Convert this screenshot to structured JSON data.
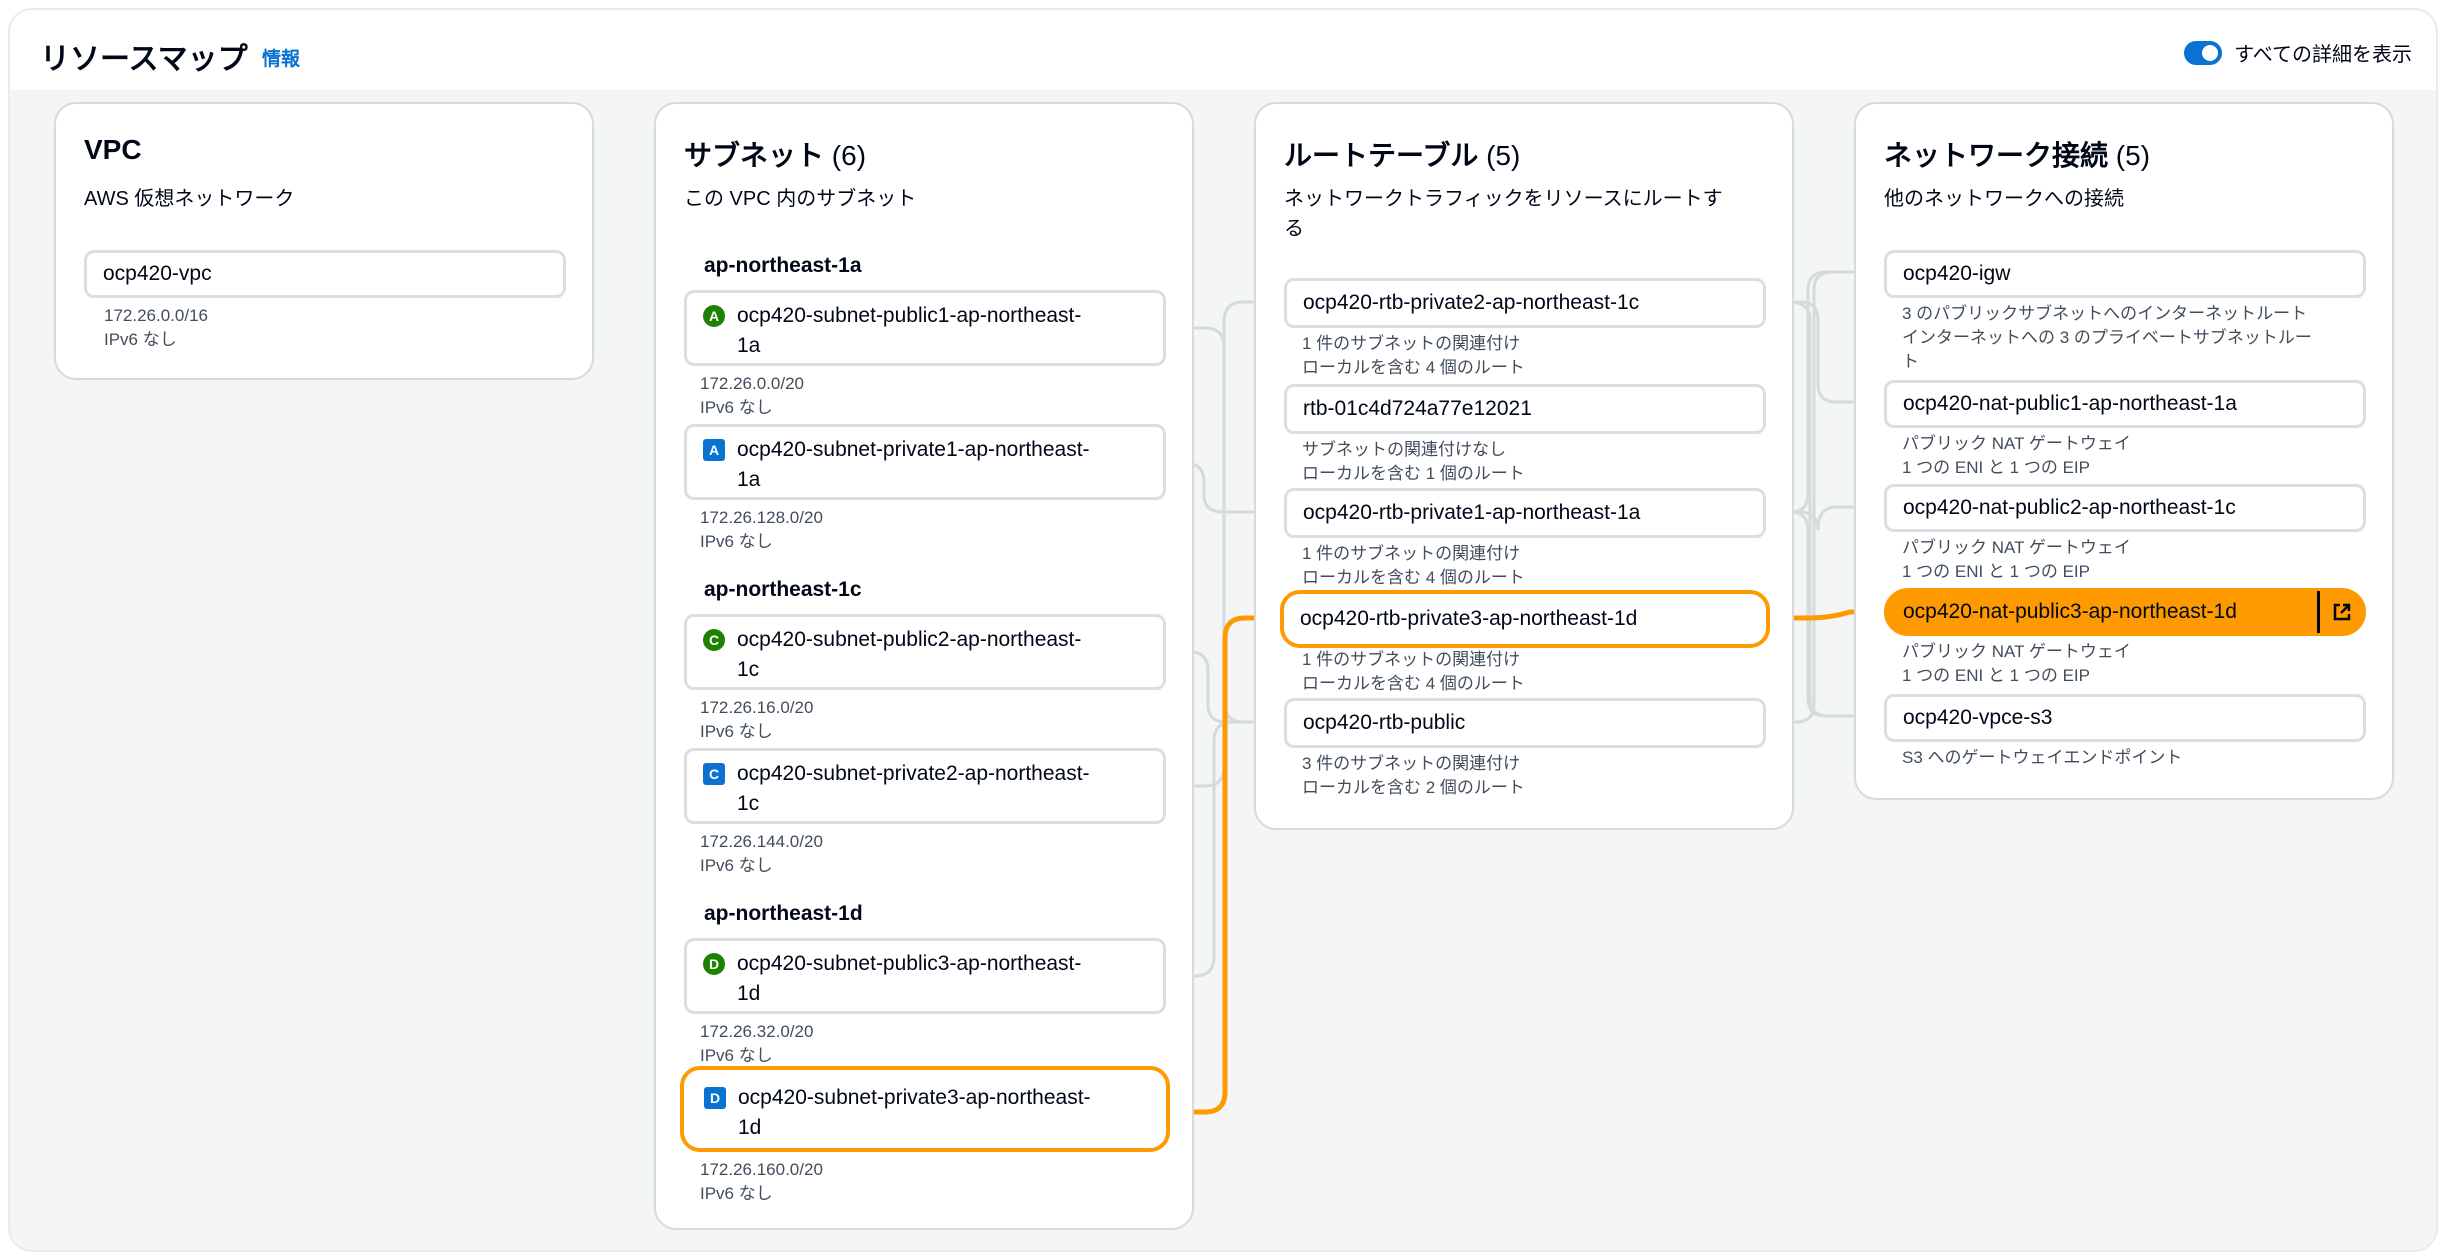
{
  "header": {
    "title": "リソースマップ",
    "info_link": "情報",
    "toggle_label": "すべての詳細を表示",
    "toggle_on": true
  },
  "colors": {
    "accent": "#ff9900",
    "link": "#0972d3",
    "public": "#1d8102",
    "private": "#0972d3"
  },
  "vpc": {
    "title": "VPC",
    "desc": "AWS 仮想ネットワーク",
    "name": "ocp420-vpc",
    "meta": [
      "172.26.0.0/16",
      "IPv6 なし"
    ]
  },
  "subnets": {
    "title": "サブネット",
    "count": "(6)",
    "desc": "この VPC 内のサブネット",
    "zones": [
      {
        "name": "ap-northeast-1a",
        "items": [
          {
            "badge": "A",
            "type": "public",
            "name": [
              "ocp420-subnet-public1-ap-northeast-",
              "1a"
            ],
            "meta": [
              "172.26.0.0/20",
              "IPv6 なし"
            ]
          },
          {
            "badge": "A",
            "type": "private",
            "name": [
              "ocp420-subnet-private1-ap-northeast-",
              "1a"
            ],
            "meta": [
              "172.26.128.0/20",
              "IPv6 なし"
            ]
          }
        ]
      },
      {
        "name": "ap-northeast-1c",
        "items": [
          {
            "badge": "C",
            "type": "public",
            "name": [
              "ocp420-subnet-public2-ap-northeast-",
              "1c"
            ],
            "meta": [
              "172.26.16.0/20",
              "IPv6 なし"
            ]
          },
          {
            "badge": "C",
            "type": "private",
            "name": [
              "ocp420-subnet-private2-ap-northeast-",
              "1c"
            ],
            "meta": [
              "172.26.144.0/20",
              "IPv6 なし"
            ]
          }
        ]
      },
      {
        "name": "ap-northeast-1d",
        "items": [
          {
            "badge": "D",
            "type": "public",
            "name": [
              "ocp420-subnet-public3-ap-northeast-",
              "1d"
            ],
            "meta": [
              "172.26.32.0/20",
              "IPv6 なし"
            ]
          },
          {
            "badge": "D",
            "type": "private",
            "name": [
              "ocp420-subnet-private3-ap-northeast-",
              "1d"
            ],
            "meta": [
              "172.26.160.0/20",
              "IPv6 なし"
            ],
            "selected": true
          }
        ]
      }
    ]
  },
  "route_tables": {
    "title": "ルートテーブル",
    "count": "(5)",
    "desc": [
      "ネットワークトラフィックをリソースにルートす",
      "る"
    ],
    "items": [
      {
        "name": "ocp420-rtb-private2-ap-northeast-1c",
        "meta": [
          "1 件のサブネットの関連付け",
          "ローカルを含む 4 個のルート"
        ]
      },
      {
        "name": "rtb-01c4d724a77e12021",
        "meta": [
          "サブネットの関連付けなし",
          "ローカルを含む 1 個のルート"
        ]
      },
      {
        "name": "ocp420-rtb-private1-ap-northeast-1a",
        "meta": [
          "1 件のサブネットの関連付け",
          "ローカルを含む 4 個のルート"
        ]
      },
      {
        "name": "ocp420-rtb-private3-ap-northeast-1d",
        "meta": [
          "1 件のサブネットの関連付け",
          "ローカルを含む 4 個のルート"
        ],
        "selected": true
      },
      {
        "name": "ocp420-rtb-public",
        "meta": [
          "3 件のサブネットの関連付け",
          "ローカルを含む 2 個のルート"
        ]
      }
    ]
  },
  "connections": {
    "title": "ネットワーク接続",
    "count": "(5)",
    "desc": "他のネットワークへの接続",
    "items": [
      {
        "name": "ocp420-igw",
        "meta": [
          "3 のパブリックサブネットへのインターネットルート",
          "インターネットへの 3 のプライベートサブネットルー",
          "ト"
        ]
      },
      {
        "name": "ocp420-nat-public1-ap-northeast-1a",
        "meta": [
          "パブリック NAT ゲートウェイ",
          "1 つの ENI と 1 つの EIP"
        ]
      },
      {
        "name": "ocp420-nat-public2-ap-northeast-1c",
        "meta": [
          "パブリック NAT ゲートウェイ",
          "1 つの ENI と 1 つの EIP"
        ]
      },
      {
        "name": "ocp420-nat-public3-ap-northeast-1d",
        "meta": [
          "パブリック NAT ゲートウェイ",
          "1 つの ENI と 1 つの EIP"
        ],
        "selected": true
      },
      {
        "name": "ocp420-vpce-s3",
        "meta": [
          "S3 へのゲートウェイエンドポイント"
        ]
      }
    ]
  }
}
